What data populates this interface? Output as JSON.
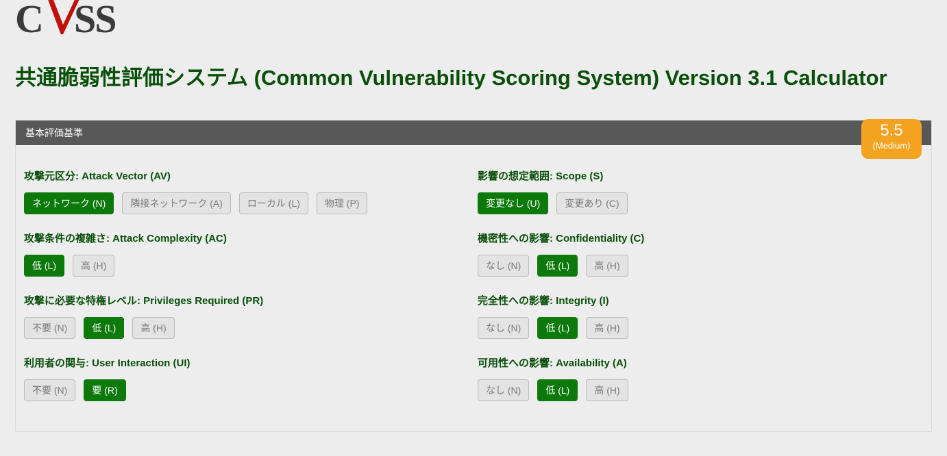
{
  "logo_text": "CVSS",
  "page_title": "共通脆弱性評価システム (Common Vulnerability Scoring System) Version 3.1 Calculator",
  "panel_title": "基本評価基準",
  "score": {
    "value": "5.5",
    "severity": "(Medium)",
    "class": "medium"
  },
  "left_metrics": [
    {
      "title": "攻撃元区分: Attack Vector (AV)",
      "options": [
        {
          "label": "ネットワーク (N)",
          "sel": true
        },
        {
          "label": "隣接ネットワーク (A)",
          "sel": false
        },
        {
          "label": "ローカル (L)",
          "sel": false
        },
        {
          "label": "物理 (P)",
          "sel": false
        }
      ]
    },
    {
      "title": "攻撃条件の複雑さ: Attack Complexity (AC)",
      "options": [
        {
          "label": "低 (L)",
          "sel": true
        },
        {
          "label": "高 (H)",
          "sel": false
        }
      ]
    },
    {
      "title": "攻撃に必要な特権レベル: Privileges Required (PR)",
      "options": [
        {
          "label": "不要 (N)",
          "sel": false
        },
        {
          "label": "低 (L)",
          "sel": true
        },
        {
          "label": "高 (H)",
          "sel": false
        }
      ]
    },
    {
      "title": "利用者の関与: User Interaction (UI)",
      "options": [
        {
          "label": "不要 (N)",
          "sel": false
        },
        {
          "label": "要 (R)",
          "sel": true
        }
      ]
    }
  ],
  "right_metrics": [
    {
      "title": "影響の想定範囲: Scope (S)",
      "options": [
        {
          "label": "変更なし (U)",
          "sel": true
        },
        {
          "label": "変更あり (C)",
          "sel": false
        }
      ]
    },
    {
      "title": "機密性への影響: Confidentiality (C)",
      "options": [
        {
          "label": "なし (N)",
          "sel": false
        },
        {
          "label": "低 (L)",
          "sel": true
        },
        {
          "label": "高 (H)",
          "sel": false
        }
      ]
    },
    {
      "title": "完全性への影響: Integrity (I)",
      "options": [
        {
          "label": "なし (N)",
          "sel": false
        },
        {
          "label": "低 (L)",
          "sel": true
        },
        {
          "label": "高 (H)",
          "sel": false
        }
      ]
    },
    {
      "title": "可用性への影響: Availability (A)",
      "options": [
        {
          "label": "なし (N)",
          "sel": false
        },
        {
          "label": "低 (L)",
          "sel": true
        },
        {
          "label": "高 (H)",
          "sel": false
        }
      ]
    }
  ]
}
